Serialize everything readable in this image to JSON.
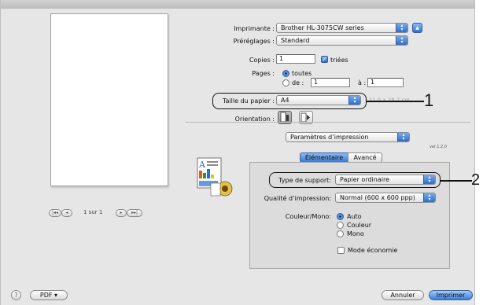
{
  "printer": {
    "label": "Imprimante :",
    "value": "Brother HL-3075CW series"
  },
  "presets": {
    "label": "Préréglages :",
    "value": "Standard"
  },
  "copies": {
    "label": "Copies :",
    "value": "1",
    "collated_label": "triées"
  },
  "pages": {
    "label": "Pages :",
    "all_label": "toutes",
    "from_label": "de :",
    "from_value": "1",
    "to_label": "à :",
    "to_value": "1"
  },
  "paper_size": {
    "label": "Taille du papier :",
    "value": "A4",
    "dimension_text": "21,0 x 29,7 cm"
  },
  "orientation": {
    "label": "Orientation :"
  },
  "section": {
    "value": "Paramètres d’impression",
    "version": "ver.1.2.0"
  },
  "tabs": [
    {
      "label": "Élémentaire",
      "selected": true
    },
    {
      "label": "Avancé",
      "selected": false
    }
  ],
  "media_type": {
    "label": "Type de support:",
    "value": "Papier ordinaire"
  },
  "quality": {
    "label": "Qualité d’impression:",
    "value": "Normal (600 x 600 ppp)"
  },
  "color_mode": {
    "label": "Couleur/Mono:",
    "options": [
      "Auto",
      "Couleur",
      "Mono"
    ],
    "selected": "Auto"
  },
  "toner_save": {
    "label": "Mode économie",
    "checked": false
  },
  "preview_nav": {
    "first": "|◂◂",
    "prev": "◂",
    "page_text": "1 sur 1",
    "next": "▸",
    "last": "▸▸|"
  },
  "footer": {
    "help": "?",
    "pdf_label": "PDF ▾",
    "cancel_label": "Annuler",
    "print_label": "Imprimer"
  },
  "callouts": [
    "1",
    "2"
  ],
  "icons": {
    "arrows": "updown-arrows-icon",
    "disclosure": "disclosure-triangle-icon"
  },
  "colors": {
    "accent": "#2f6dcb",
    "dialog_bg": "#e6e6e6"
  }
}
